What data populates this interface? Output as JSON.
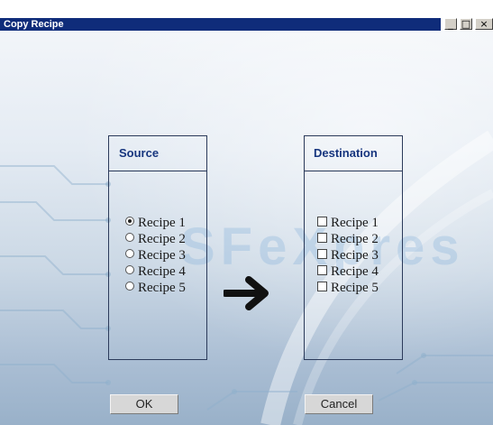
{
  "window": {
    "title": "Copy Recipe",
    "controls": {
      "minimize": "_",
      "maximize": "□",
      "close": "×"
    }
  },
  "watermark": "SFeXpres",
  "source": {
    "header": "Source",
    "selected_index": 0,
    "items": [
      {
        "label": "Recipe 1",
        "checked": true
      },
      {
        "label": "Recipe 2",
        "checked": false
      },
      {
        "label": "Recipe 3",
        "checked": false
      },
      {
        "label": "Recipe 4",
        "checked": false
      },
      {
        "label": "Recipe 5",
        "checked": false
      }
    ]
  },
  "destination": {
    "header": "Destination",
    "items": [
      {
        "label": "Recipe 1",
        "checked": false
      },
      {
        "label": "Recipe 2",
        "checked": false
      },
      {
        "label": "Recipe 3",
        "checked": false
      },
      {
        "label": "Recipe 4",
        "checked": false
      },
      {
        "label": "Recipe 5",
        "checked": false
      }
    ]
  },
  "icons": {
    "copy_direction": "right-arrow-icon"
  },
  "buttons": {
    "ok": "OK",
    "cancel": "Cancel"
  }
}
